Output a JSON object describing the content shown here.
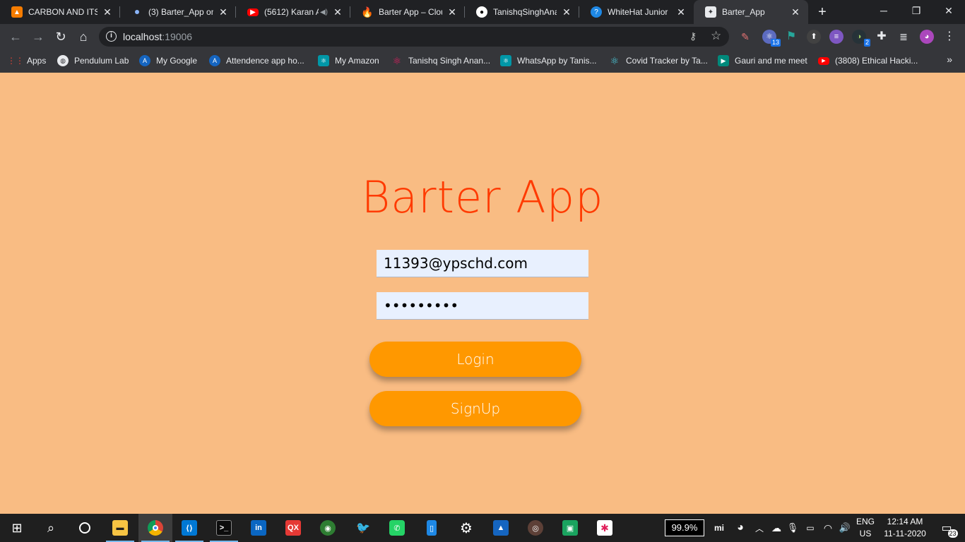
{
  "browser": {
    "tabs": [
      {
        "title": "CARBON AND ITS",
        "icon": "orange-doc-icon",
        "color": "#f57c00"
      },
      {
        "title": "(3) Barter_App on",
        "icon": "dot-icon",
        "color": "#8ab4f8"
      },
      {
        "title": "(5612) Karan A",
        "icon": "youtube-icon",
        "color": "#ff0000"
      },
      {
        "title": "Barter App – Cloud",
        "icon": "firebase-icon",
        "color": "#ffa000"
      },
      {
        "title": "TanishqSinghAnan",
        "icon": "github-icon",
        "color": "#ffffff"
      },
      {
        "title": "WhiteHat Junior",
        "icon": "whitehat-icon",
        "color": "#1e88e5"
      },
      {
        "title": "Barter_App",
        "icon": "expo-icon",
        "color": "#e8eaed"
      }
    ],
    "address": {
      "host": "localhost",
      "port": ":19006"
    },
    "extension_badges": {
      "ext2": "13",
      "ext7": "2"
    },
    "bookmarks": [
      {
        "label": "Apps",
        "icon": "apps-grid-icon"
      },
      {
        "label": "Pendulum Lab",
        "icon": "globe-icon"
      },
      {
        "label": "My Google",
        "icon": "angular-icon"
      },
      {
        "label": "Attendence app ho...",
        "icon": "angular-icon"
      },
      {
        "label": "My Amazon",
        "icon": "react-icon"
      },
      {
        "label": "Tanishq Singh Anan...",
        "icon": "react-icon"
      },
      {
        "label": "WhatsApp by Tanis...",
        "icon": "react-icon"
      },
      {
        "label": "Covid Tracker by Ta...",
        "icon": "react-icon"
      },
      {
        "label": "Gauri and me meet",
        "icon": "meet-icon"
      },
      {
        "label": "(3808) Ethical Hacki...",
        "icon": "youtube-icon"
      }
    ]
  },
  "app": {
    "title": "Barter App",
    "email_value": "11393@ypschd.com",
    "password_value": "•••••••••",
    "login_label": "Login",
    "signup_label": "SignUp",
    "colors": {
      "background": "#f9bc83",
      "title": "#ff3a00",
      "button": "#ff9800",
      "input": "#e8f0fe"
    }
  },
  "taskbar": {
    "zoom": "99.9%",
    "lang_top": "ENG",
    "lang_bottom": "US",
    "time": "12:14 AM",
    "date": "11-11-2020",
    "notifications": "23"
  }
}
